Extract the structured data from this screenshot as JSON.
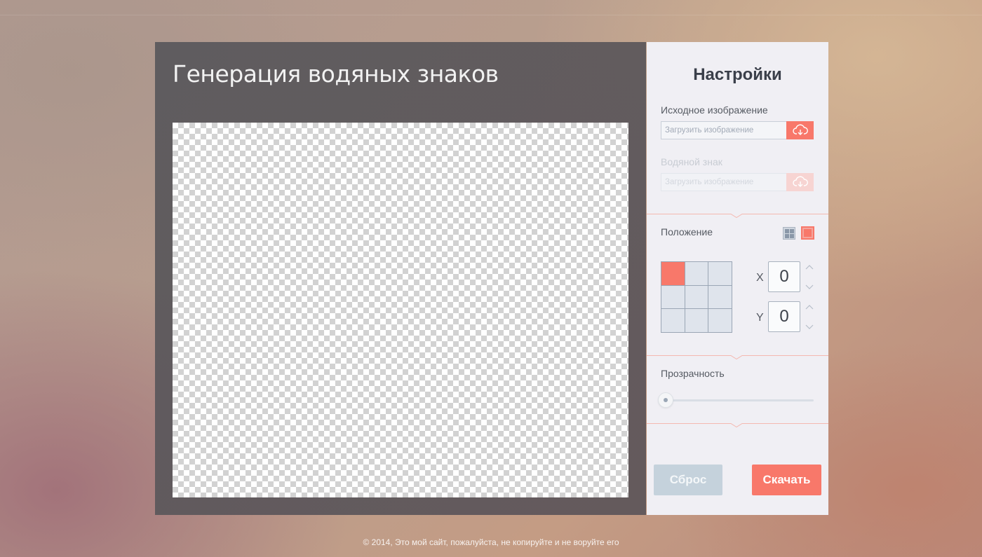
{
  "main": {
    "title": "Генерация водяных знаков"
  },
  "settings": {
    "title": "Настройки",
    "source_image": {
      "label": "Исходное изображение",
      "placeholder": "Загрузить изображение",
      "upload_icon": "cloud-download-icon"
    },
    "watermark": {
      "label": "Водяной знак",
      "placeholder": "Загрузить изображение",
      "upload_icon": "cloud-download-icon",
      "disabled": true
    },
    "position": {
      "label": "Положение",
      "modes": [
        "tile-grid-icon",
        "single-square-icon"
      ],
      "active_mode": "single",
      "active_cell": 0,
      "x_label": "X",
      "x_value": "0",
      "y_label": "Y",
      "y_value": "0"
    },
    "opacity": {
      "label": "Прозрачность",
      "value": 0
    },
    "reset_label": "Сброс",
    "download_label": "Скачать"
  },
  "footer": {
    "text": "© 2014, Это мой сайт, пожалуйста, не копируйте и не воруйте его"
  },
  "colors": {
    "accent": "#f8786a",
    "panel_dark": "#5c5759",
    "panel_light": "#f0eff4",
    "reset_button": "#c5d2dc"
  }
}
